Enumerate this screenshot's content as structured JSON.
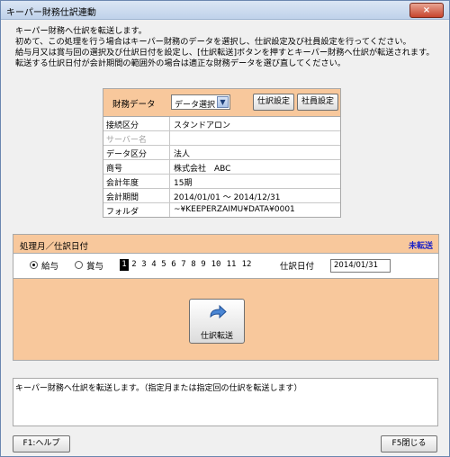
{
  "window": {
    "title": "キーパー財務仕訳連動",
    "close_label": "×"
  },
  "intro_lines": [
    "キーパー財務へ仕訳を転送します。",
    "初めて、この処理を行う場合はキーパー財務のデータを選択し、仕訳設定及び社員設定を行ってください。",
    "給与月又は賞与回の選択及び仕訳日付を設定し、[仕訳転送]ボタンを押すとキーパー財務へ仕訳が転送されます。",
    "転送する仕訳日付が会計期間の範囲外の場合は適正な財務データを選び直してください。"
  ],
  "data_panel": {
    "label": "財務データ",
    "select_value": "データ選択",
    "journal_settings_button": "仕訳設定",
    "employee_settings_button": "社員設定",
    "rows": [
      {
        "key": "接続区分",
        "value": "スタンドアロン"
      },
      {
        "key": "サーバー名",
        "value": ""
      },
      {
        "key": "データ区分",
        "value": "法人"
      },
      {
        "key": "商号",
        "value": "株式会社　ABC"
      },
      {
        "key": "会計年度",
        "value": "15期"
      },
      {
        "key": "会計期間",
        "value": "2014/01/01 ～ 2014/12/31"
      },
      {
        "key": "フォルダ",
        "value": "~¥KEEPERZAIMU¥DATA¥0001"
      }
    ]
  },
  "process": {
    "label": "処理月／仕訳日付",
    "status": "未転送",
    "radio_salary": "給与",
    "radio_bonus": "賞与",
    "selected_type": "給与",
    "months": [
      "1",
      "2",
      "3",
      "4",
      "5",
      "6",
      "7",
      "8",
      "9",
      "10",
      "11",
      "12"
    ],
    "selected_month": "1",
    "date_label": "仕訳日付",
    "date_value": "2014/01/31",
    "transfer_button": "仕訳転送"
  },
  "message": "キーパー財務へ仕訳を転送します。（指定月または指定回の仕訳を転送します）",
  "footer": {
    "help_button": "F1:ヘルプ",
    "close_button": "F5閉じる"
  },
  "colors": {
    "panel_header": "#f8c89c",
    "status_text": "#1a22c8",
    "title_gradient": "#bfd2ea"
  }
}
